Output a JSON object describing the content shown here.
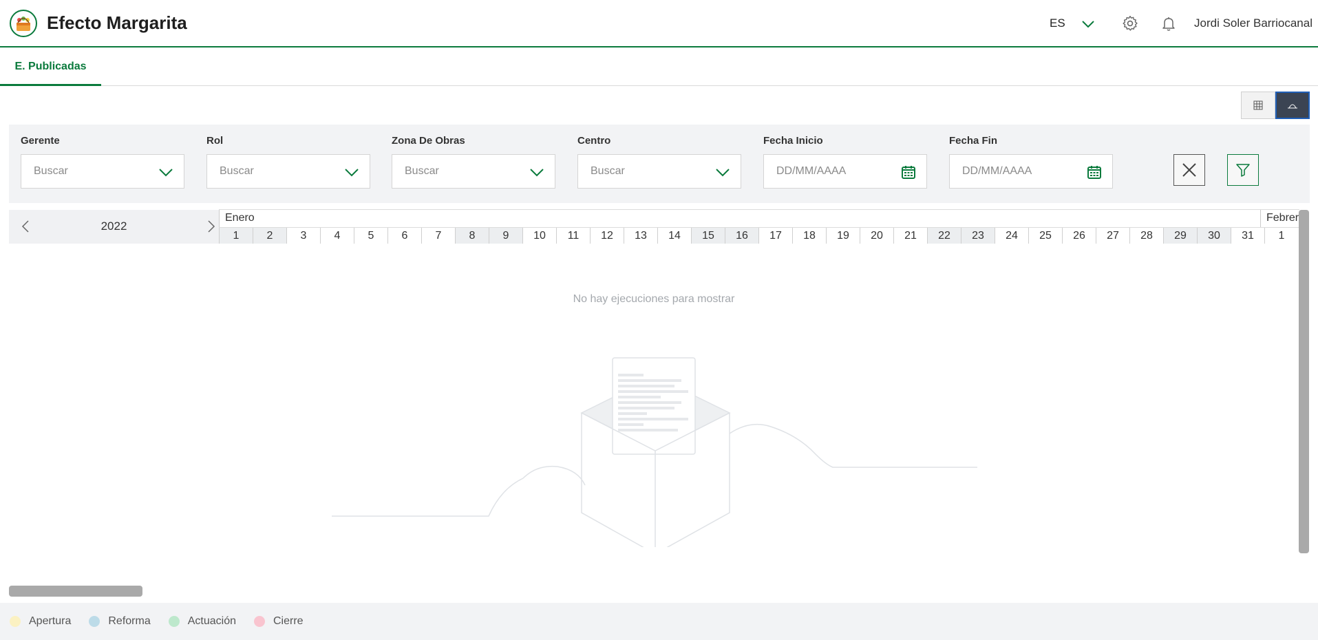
{
  "header": {
    "title": "Efecto Margarita",
    "language": "ES",
    "user_name": "Jordi Soler Barriocanal",
    "accent_color": "#0a7a3c"
  },
  "tabs": [
    {
      "label": "E. Publicadas",
      "active": true
    }
  ],
  "view_toggle": {
    "options": [
      "table-view-icon",
      "timeline-view-icon"
    ],
    "active": "timeline-view-icon"
  },
  "filters": {
    "gerente": {
      "label": "Gerente",
      "placeholder": "Buscar"
    },
    "rol": {
      "label": "Rol",
      "placeholder": "Buscar"
    },
    "zona": {
      "label": "Zona De Obras",
      "placeholder": "Buscar"
    },
    "centro": {
      "label": "Centro",
      "placeholder": "Buscar"
    },
    "fecha_inicio": {
      "label": "Fecha Inicio",
      "placeholder": "DD/MM/AAAA"
    },
    "fecha_fin": {
      "label": "Fecha Fin",
      "placeholder": "DD/MM/AAAA"
    }
  },
  "calendar": {
    "year": "2022",
    "months": [
      "Enero",
      "Febrero"
    ],
    "days": [
      "1",
      "2",
      "3",
      "4",
      "5",
      "6",
      "7",
      "8",
      "9",
      "10",
      "11",
      "12",
      "13",
      "14",
      "15",
      "16",
      "17",
      "18",
      "19",
      "20",
      "21",
      "22",
      "23",
      "24",
      "25",
      "26",
      "27",
      "28",
      "29",
      "30",
      "31",
      "1"
    ],
    "weekend_days": [
      "1",
      "2",
      "8",
      "9",
      "15",
      "16",
      "22",
      "23",
      "29",
      "30"
    ]
  },
  "empty_message": "No hay ejecuciones para mostrar",
  "legend": [
    {
      "label": "Apertura",
      "color": "#fbf1c2"
    },
    {
      "label": "Reforma",
      "color": "#bcdbe8"
    },
    {
      "label": "Actuación",
      "color": "#bde8cc"
    },
    {
      "label": "Cierre",
      "color": "#f9c4cf"
    }
  ]
}
